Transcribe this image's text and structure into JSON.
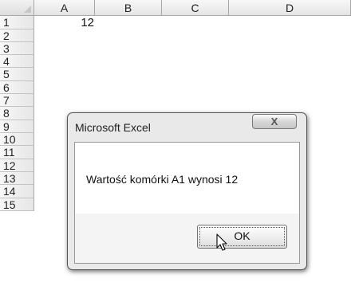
{
  "sheet": {
    "columns": [
      "A",
      "B",
      "C",
      "D"
    ],
    "rows": [
      "1",
      "2",
      "3",
      "4",
      "5",
      "6",
      "7",
      "8",
      "9",
      "10",
      "11",
      "12",
      "13",
      "14",
      "15"
    ],
    "cell_a1": "12"
  },
  "dialog": {
    "title": "Microsoft Excel",
    "close_label": "X",
    "message": "Wartość komórki A1 wynosi 12",
    "ok_label": "OK"
  }
}
